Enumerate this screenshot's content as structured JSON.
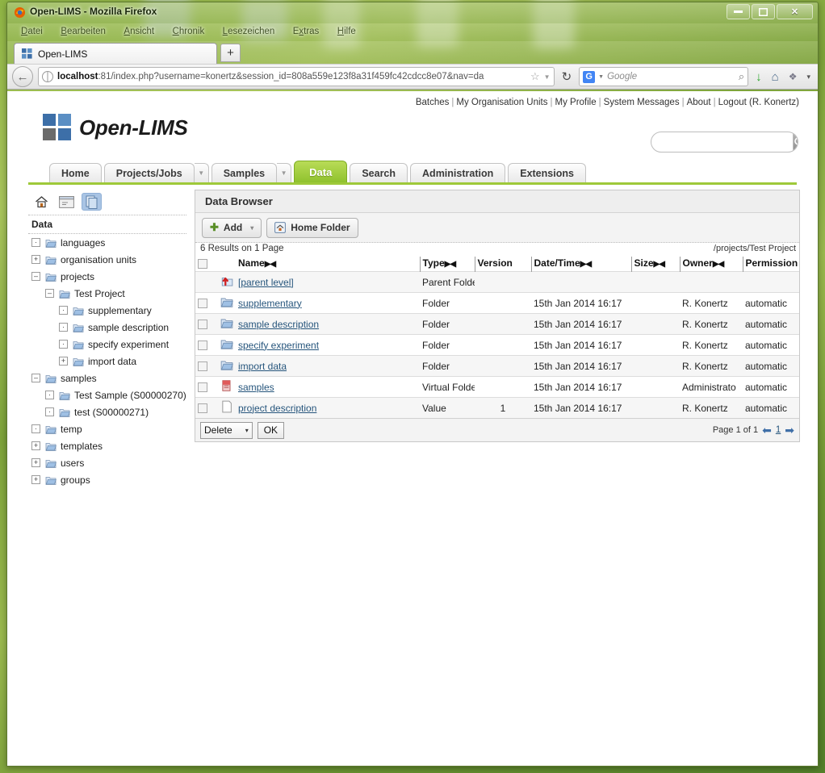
{
  "desktop": {
    "wallpaper_colors": [
      "#8fb544",
      "#7da33a",
      "#53802a"
    ]
  },
  "window": {
    "title": "Open-LIMS - Mozilla Firefox",
    "app_icon": "firefox-icon",
    "buttons": {
      "minimize": "–",
      "maximize": "□",
      "close": "✕"
    }
  },
  "menubar": {
    "items": [
      {
        "label": "Datei",
        "accel": "D"
      },
      {
        "label": "Bearbeiten",
        "accel": "B"
      },
      {
        "label": "Ansicht",
        "accel": "A"
      },
      {
        "label": "Chronik",
        "accel": "C"
      },
      {
        "label": "Lesezeichen",
        "accel": "L"
      },
      {
        "label": "Extras",
        "accel": "x"
      },
      {
        "label": "Hilfe",
        "accel": "H"
      }
    ]
  },
  "tabstrip": {
    "tab_label": "Open-LIMS",
    "tab_favicon": "open-lims-favicon",
    "new_tab_label": "+"
  },
  "navbar": {
    "back_glyph": "←",
    "url_host": "localhost",
    "url_rest": ":81/index.php?username=konertz&session_id=808a559e123f8a31f459fc42cdcc8e07&nav=da",
    "bookmark_glyph": "☆",
    "dropmarker_glyph": "▼",
    "reload_glyph": "↻",
    "search_engine": "G",
    "search_placeholder": "Google",
    "search_glyph": "⌕",
    "download_glyph": "↓",
    "home_glyph": "⌂",
    "addon_glyph": "❖",
    "overflow_glyph": "▾"
  },
  "app": {
    "brand": "Open-LIMS",
    "logo_colors": [
      "#3d6fa8",
      "#5b8fc4",
      "#6b6b6b",
      "#3d6fa8"
    ],
    "usernav": [
      "Batches",
      "My Organisation Units",
      "My Profile",
      "System Messages",
      "About",
      "Logout (R. Konertz)"
    ],
    "search": {
      "value": "",
      "placeholder": "",
      "button_icon": "search-icon"
    },
    "tabs": [
      {
        "label": "Home",
        "active": false,
        "caret": false
      },
      {
        "label": "Projects/Jobs",
        "active": false,
        "caret": true
      },
      {
        "label": "Samples",
        "active": false,
        "caret": true
      },
      {
        "label": "Data",
        "active": true,
        "caret": false
      },
      {
        "label": "Search",
        "active": false,
        "caret": false
      },
      {
        "label": "Administration",
        "active": false,
        "caret": false
      },
      {
        "label": "Extensions",
        "active": false,
        "caret": false
      }
    ],
    "accent_color": "#9ec93a"
  },
  "sidebar": {
    "icons": [
      {
        "name": "home-icon",
        "selected": false
      },
      {
        "name": "window-icon",
        "selected": false
      },
      {
        "name": "pages-icon",
        "selected": true
      }
    ],
    "title": "Data",
    "tree": [
      {
        "label": "languages",
        "indent": 0,
        "toggle": "·",
        "icon": "folder-icon"
      },
      {
        "label": "organisation units",
        "indent": 0,
        "toggle": "+",
        "icon": "folder-icon"
      },
      {
        "label": "projects",
        "indent": 0,
        "toggle": "–",
        "icon": "folder-icon"
      },
      {
        "label": "Test Project",
        "indent": 1,
        "toggle": "–",
        "icon": "folder-icon"
      },
      {
        "label": "supplementary",
        "indent": 2,
        "toggle": "·",
        "icon": "folder-icon"
      },
      {
        "label": "sample description",
        "indent": 2,
        "toggle": "·",
        "icon": "folder-icon"
      },
      {
        "label": "specify experiment",
        "indent": 2,
        "toggle": "·",
        "icon": "folder-icon"
      },
      {
        "label": "import data",
        "indent": 2,
        "toggle": "+",
        "icon": "folder-icon"
      },
      {
        "label": "samples",
        "indent": 0,
        "toggle": "–",
        "icon": "folder-icon"
      },
      {
        "label": "Test Sample (S00000270)",
        "indent": 1,
        "toggle": "·",
        "icon": "folder-icon"
      },
      {
        "label": "test (S00000271)",
        "indent": 1,
        "toggle": "·",
        "icon": "folder-icon"
      },
      {
        "label": "temp",
        "indent": 0,
        "toggle": "·",
        "icon": "folder-icon"
      },
      {
        "label": "templates",
        "indent": 0,
        "toggle": "+",
        "icon": "folder-icon"
      },
      {
        "label": "users",
        "indent": 0,
        "toggle": "+",
        "icon": "folder-icon"
      },
      {
        "label": "groups",
        "indent": 0,
        "toggle": "+",
        "icon": "folder-icon"
      }
    ]
  },
  "data_browser": {
    "panel_title": "Data Browser",
    "toolbar": {
      "add_label": "Add",
      "add_icon": "plus-icon",
      "add_caret": "▾",
      "home_folder_label": "Home Folder",
      "home_folder_icon": "home-folder-icon"
    },
    "results_text": "6 Results on 1 Page",
    "path": "/projects/Test Project",
    "columns": [
      {
        "label": "Name",
        "sortable": true
      },
      {
        "label": "Type",
        "sortable": true
      },
      {
        "label": "Version",
        "sortable": false
      },
      {
        "label": "Date/Time",
        "sortable": true
      },
      {
        "label": "Size",
        "sortable": true
      },
      {
        "label": "Owner",
        "sortable": true
      },
      {
        "label": "Permission",
        "sortable": false
      }
    ],
    "sort_glyph": "▶◀",
    "rows": [
      {
        "checkbox": false,
        "icon": "parent-folder-icon",
        "name": "[parent level]",
        "type": "Parent Folde",
        "version": "",
        "datetime": "",
        "size": "",
        "owner": "",
        "permission": ""
      },
      {
        "checkbox": true,
        "icon": "folder-icon",
        "name": "supplementary",
        "type": "Folder",
        "version": "",
        "datetime": "15th Jan 2014 16:17",
        "size": "",
        "owner": "R. Konertz",
        "permission": "automatic"
      },
      {
        "checkbox": true,
        "icon": "folder-icon",
        "name": "sample description",
        "type": "Folder",
        "version": "",
        "datetime": "15th Jan 2014 16:17",
        "size": "",
        "owner": "R. Konertz",
        "permission": "automatic"
      },
      {
        "checkbox": true,
        "icon": "folder-icon",
        "name": "specify experiment",
        "type": "Folder",
        "version": "",
        "datetime": "15th Jan 2014 16:17",
        "size": "",
        "owner": "R. Konertz",
        "permission": "automatic"
      },
      {
        "checkbox": true,
        "icon": "folder-icon",
        "name": "import data",
        "type": "Folder",
        "version": "",
        "datetime": "15th Jan 2014 16:17",
        "size": "",
        "owner": "R. Konertz",
        "permission": "automatic"
      },
      {
        "checkbox": true,
        "icon": "virtual-folder-icon",
        "name": "samples",
        "type": "Virtual Folde",
        "version": "",
        "datetime": "15th Jan 2014 16:17",
        "size": "",
        "owner": "Administrato",
        "permission": "automatic"
      },
      {
        "checkbox": true,
        "icon": "value-icon",
        "name": "project description",
        "type": "Value",
        "version": "1",
        "datetime": "15th Jan 2014 16:17",
        "size": "",
        "owner": "R. Konertz",
        "permission": "automatic"
      }
    ],
    "footer": {
      "action_label": "Delete",
      "action_caret": "▾",
      "ok_label": "OK",
      "page_text": "Page 1 of 1",
      "prev_glyph": "⬅",
      "next_glyph": "➡",
      "current_page": "1"
    }
  }
}
